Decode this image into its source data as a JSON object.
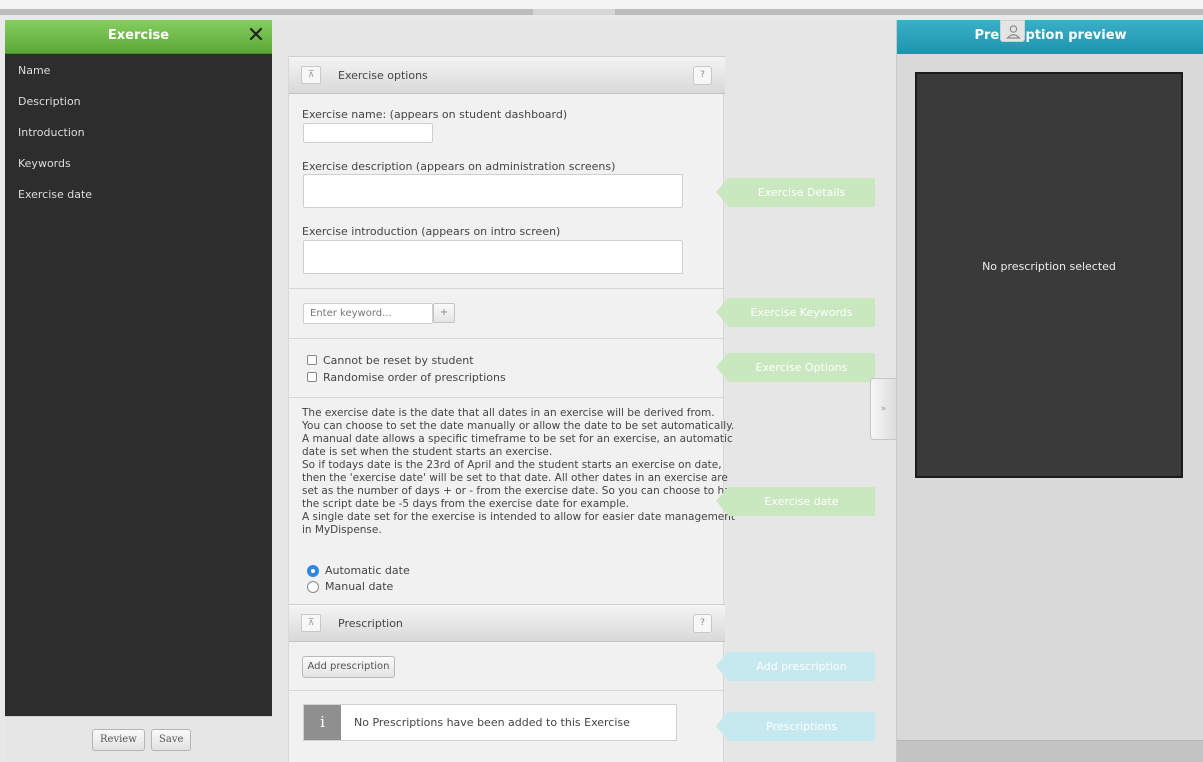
{
  "sidebar": {
    "title": "Exercise",
    "close_icon": "close-icon",
    "items": [
      {
        "label": "Name"
      },
      {
        "label": "Description"
      },
      {
        "label": "Introduction"
      },
      {
        "label": "Keywords"
      },
      {
        "label": "Exercise date"
      }
    ],
    "review_label": "Review",
    "save_label": "Save",
    "header_color": "#6cbb47"
  },
  "exercise_options": {
    "title": "Exercise options",
    "help_label": "?",
    "name_label": "Exercise name: (appears on student dashboard)",
    "name_value": "",
    "description_label": "Exercise description (appears on administration screens)",
    "description_value": "",
    "introduction_label": "Exercise introduction (appears on intro screen)",
    "introduction_value": "",
    "keyword_placeholder": "Enter keyword...",
    "add_keyword_label": "+",
    "checkbox_reset": "Cannot be reset by student",
    "checkbox_randomise": "Randomise order of prescriptions",
    "date_description": [
      "The exercise date is the date that all dates in an exercise will be derived from.",
      "You can choose to set the date manually or allow the date to be set automatically.",
      "A manual date allows a specific timeframe to be set for an exercise, an automatic",
      "date is set when the student starts an exercise.",
      "So if todays date is the 23rd of April and the student starts an exercise on date,",
      "then the 'exercise date' will be set to that date. All other dates in an exercise are",
      "set as the number of days + or - from the exercise date. So you can choose to have",
      "the script date be -5 days from the exercise date for example.",
      "A single date set for the exercise is intended to allow for easier date management",
      "in MyDispense."
    ],
    "radio_automatic": "Automatic date",
    "radio_manual": "Manual date",
    "selected_date_mode": "Automatic date"
  },
  "prescription": {
    "title": "Prescription",
    "help_label": "?",
    "add_button_label": "Add prescription",
    "info_icon": "i",
    "empty_message": "No Prescriptions have been added to this Exercise"
  },
  "callouts": {
    "details": "Exercise Details",
    "keywords": "Exercise Keywords",
    "options": "Exercise Options",
    "date": "Exercise date",
    "add_prescription": "Add prescription",
    "prescriptions": "Prescriptions",
    "green_color": "#c9e8bf",
    "blue_color": "#c6e9f0"
  },
  "expand_tab_label": "»",
  "preview": {
    "title": "Prescription preview",
    "empty_text": "No prescription selected",
    "header_color": "#2aa3bd",
    "user_icon": "user-icon"
  }
}
